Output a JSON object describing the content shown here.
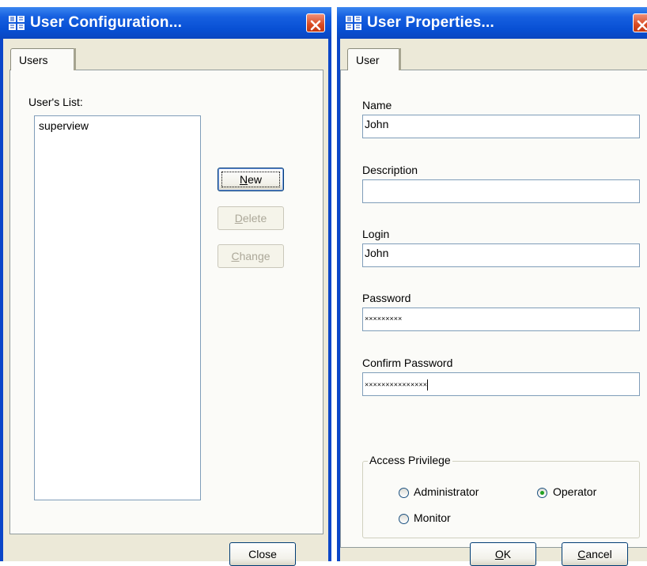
{
  "user_config": {
    "title": "User Configuration...",
    "tab": "Users",
    "list_label": "User's List:",
    "users": [
      "superview"
    ],
    "buttons": {
      "new": "New",
      "delete": "Delete",
      "change": "Change",
      "close": "Close"
    },
    "new_mnemonic": "N",
    "new_rest": "ew",
    "delete_mnemonic": "D",
    "delete_rest": "elete",
    "change_mnemonic": "C",
    "change_rest": "hange"
  },
  "user_properties": {
    "title": "User Properties...",
    "tab": "User",
    "fields": {
      "name_label": "Name",
      "name_value": "John",
      "description_label": "Description",
      "description_value": "",
      "login_label": "Login",
      "login_value": "John",
      "password_label": "Password",
      "password_value": "×××××××××",
      "confirm_label": "Confirm Password",
      "confirm_value": "×××××××××××××××"
    },
    "access": {
      "title": "Access Privilege",
      "options": [
        "Administrator",
        "Operator",
        "Monitor"
      ],
      "selected": "Operator"
    },
    "buttons": {
      "ok": "OK",
      "ok_mnemonic": "O",
      "ok_rest": "K",
      "cancel": "Cancel",
      "cancel_mnemonic": "C",
      "cancel_rest": "ancel"
    }
  },
  "colors": {
    "titlebar": "#0850d4",
    "face": "#ece9d8",
    "close": "#d94a20"
  }
}
